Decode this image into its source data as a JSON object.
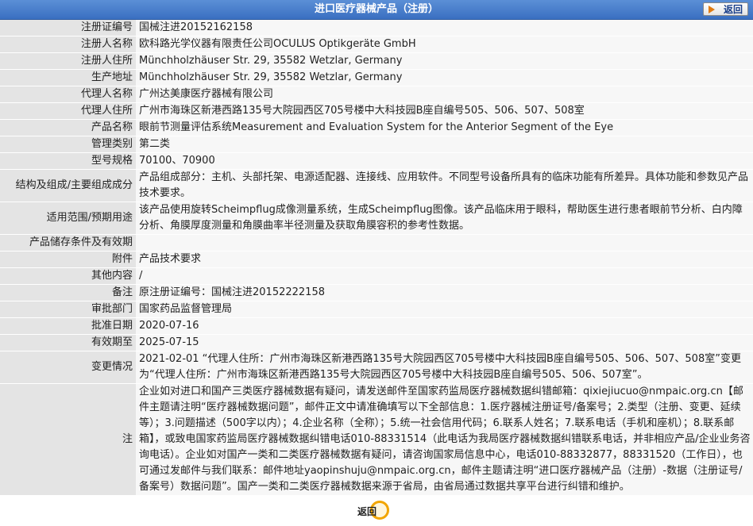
{
  "header": {
    "title": "进口医疗器械产品（注册）",
    "back_label": "返回"
  },
  "rows": [
    {
      "label": "注册证编号",
      "value": "国械注进20152162158"
    },
    {
      "label": "注册人名称",
      "value": "欧科路光学仪器有限责任公司OCULUS Optikgeräte GmbH"
    },
    {
      "label": "注册人住所",
      "value": "Münchholzhäuser Str. 29, 35582 Wetzlar, Germany"
    },
    {
      "label": "生产地址",
      "value": "Münchholzhäuser Str. 29, 35582 Wetzlar, Germany"
    },
    {
      "label": "代理人名称",
      "value": "广州达美康医疗器械有限公司"
    },
    {
      "label": "代理人住所",
      "value": "广州市海珠区新港西路135号大院园西区705号楼中大科技园B座自编号505、506、507、508室"
    },
    {
      "label": "产品名称",
      "value": "眼前节测量评估系统Measurement and Evaluation System for the Anterior Segment of the Eye"
    },
    {
      "label": "管理类别",
      "value": "第二类"
    },
    {
      "label": "型号规格",
      "value": "70100、70900"
    },
    {
      "label": "结构及组成/主要组成成分",
      "value": "产品组成部分：主机、头部托架、电源适配器、连接线、应用软件。不同型号设备所具有的临床功能有所差异。具体功能和参数见产品技术要求。"
    },
    {
      "label": "适用范围/预期用途",
      "value": "该产品使用旋转Scheimpflug成像测量系统，生成Scheimpflug图像。该产品临床用于眼科，帮助医生进行患者眼前节分析、白内障分析、角膜厚度测量和角膜曲率半径测量及获取角膜容积的参考性数据。"
    },
    {
      "label": "产品储存条件及有效期",
      "value": ""
    },
    {
      "label": "附件",
      "value": "产品技术要求"
    },
    {
      "label": "其他内容",
      "value": "/"
    },
    {
      "label": "备注",
      "value": "原注册证编号：国械注进20152222158"
    },
    {
      "label": "审批部门",
      "value": "国家药品监督管理局"
    },
    {
      "label": "批准日期",
      "value": "2020-07-16"
    },
    {
      "label": "有效期至",
      "value": "2025-07-15"
    },
    {
      "label": "变更情况",
      "value": "2021-02-01 “代理人住所：广州市海珠区新港西路135号大院园西区705号楼中大科技园B座自编号505、506、507、508室”变更为“代理人住所：广州市海珠区新港西路135号大院园西区705号楼中大科技园B座自编号505、506、507室”。"
    },
    {
      "label": "注",
      "value": "企业如对进口和国产三类医疗器械数据有疑问，请发送邮件至国家药监局医疗器械数据纠错邮箱：qixiejiucuo@nmpaic.org.cn【邮件主题请注明“医疗器械数据问题”，邮件正文中请准确填写以下全部信息：1.医疗器械注册证号/备案号；2.类型（注册、变更、延续等）；3.问题描述（500字以内）；4.企业名称（全称）；5.统一社会信用代码；6.联系人姓名；7.联系电话（手机和座机）；8.联系邮箱】，或致电国家药监局医疗器械数据纠错电话010-88331514（此电话为我局医疗器械数据纠错联系电话，并非相应产品/企业业务咨询电话）。企业如对国产一类和二类医疗器械数据有疑问，请咨询国家局信息中心，电话010-88332877，88331520（工作日），也可通过发邮件与我们联系：邮件地址yaopinshuju@nmpaic.org.cn，邮件主题请注明“进口医疗器械产品（注册）-数据（注册证号/备案号）数据问题”。国产一类和二类医疗器械数据来源于省局，由省局通过数据共享平台进行纠错和维护。"
    }
  ],
  "footer": {
    "back_label": "返回"
  }
}
